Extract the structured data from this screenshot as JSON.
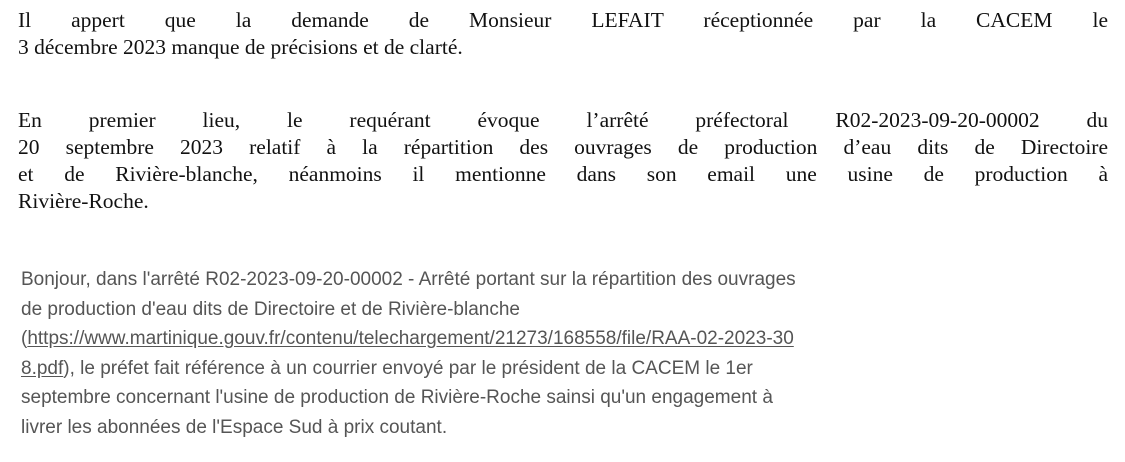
{
  "paragraph_1": {
    "lines": [
      "Il appert que la demande de Monsieur LEFAIT réceptionnée par la CACEM le",
      "3 décembre 2023 manque de précisions et de clarté."
    ]
  },
  "paragraph_2": {
    "lines": [
      "En premier lieu, le requérant évoque l’arrêté préfectoral R02-2023-09-20-00002 du",
      "20 septembre 2023 relatif à la répartition des ouvrages de production d’eau dits de Directoire",
      "et de Rivière-blanche, néanmoins il mentionne dans son email une usine de production à",
      "Rivière-Roche."
    ]
  },
  "email_quote": {
    "line_1": "Bonjour, dans l'arrêté R02-2023-09-20-00002 - Arrêté portant sur la répartition des ouvrages",
    "line_2": "de production d'eau dits de Directoire et de Rivière-blanche",
    "link_open_paren": "(",
    "link_part_1": "https://www.martinique.gouv.fr/contenu/telechargement/21273/168558/file/RAA-02-2023-30",
    "link_part_2": "8.pdf",
    "line_4_rest": "), le préfet fait référence à un courrier envoyé par le président de la CACEM le 1er",
    "line_5": "septembre concernant l'usine de production de Rivière-Roche sainsi qu'un engagement à",
    "line_6": "livrer les abonnées de l'Espace Sud à prix coutant."
  }
}
